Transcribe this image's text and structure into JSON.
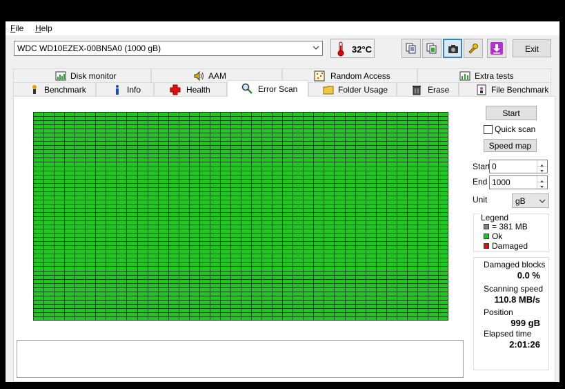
{
  "menu": {
    "file": "File",
    "file_key": "F",
    "file_rest": "ile",
    "help": "Help",
    "help_key": "H",
    "help_rest": "elp"
  },
  "toolbar": {
    "drive": "WDC WD10EZEX-00BN5A0 (1000 gB)",
    "temperature": "32",
    "temp_unit": "°C",
    "exit_label": "Exit",
    "icons": [
      "copy-text-icon",
      "copy-report-icon",
      "camera-icon",
      "tools-icon",
      "down-arrow-icon"
    ]
  },
  "tabs": {
    "row1": [
      "Disk monitor",
      "AAM",
      "Random Access",
      "Extra tests"
    ],
    "row2": [
      "Benchmark",
      "Info",
      "Health",
      "Error Scan",
      "Folder Usage",
      "Erase",
      "File Benchmark"
    ],
    "active": "Error Scan"
  },
  "scan": {
    "start_label": "Start",
    "quick_scan_label": "Quick scan",
    "quick_scan_checked": false,
    "speed_map_label": "Speed map",
    "start_field_label": "Start",
    "start_value": "0",
    "end_field_label": "End",
    "end_value": "1000",
    "unit_label": "Unit",
    "unit_value": "gB"
  },
  "legend": {
    "title": "Legend",
    "block_size": "= 381 MB",
    "ok": "Ok",
    "damaged": "Damaged",
    "colors": {
      "block": "#808080",
      "ok": "#22c622",
      "damaged": "#dd1111"
    }
  },
  "stats": {
    "damaged_blocks_label": "Damaged blocks",
    "damaged_blocks_value": "0.0 %",
    "scanning_speed_label": "Scanning speed",
    "scanning_speed_value": "110.8 MB/s",
    "position_label": "Position",
    "position_value": "999 gB",
    "elapsed_label": "Elapsed time",
    "elapsed_value": "2:01:26"
  },
  "grid": {
    "cols": 40,
    "rows": 50,
    "cell_color": "#22c622",
    "line_color": "#0a4a0a"
  }
}
